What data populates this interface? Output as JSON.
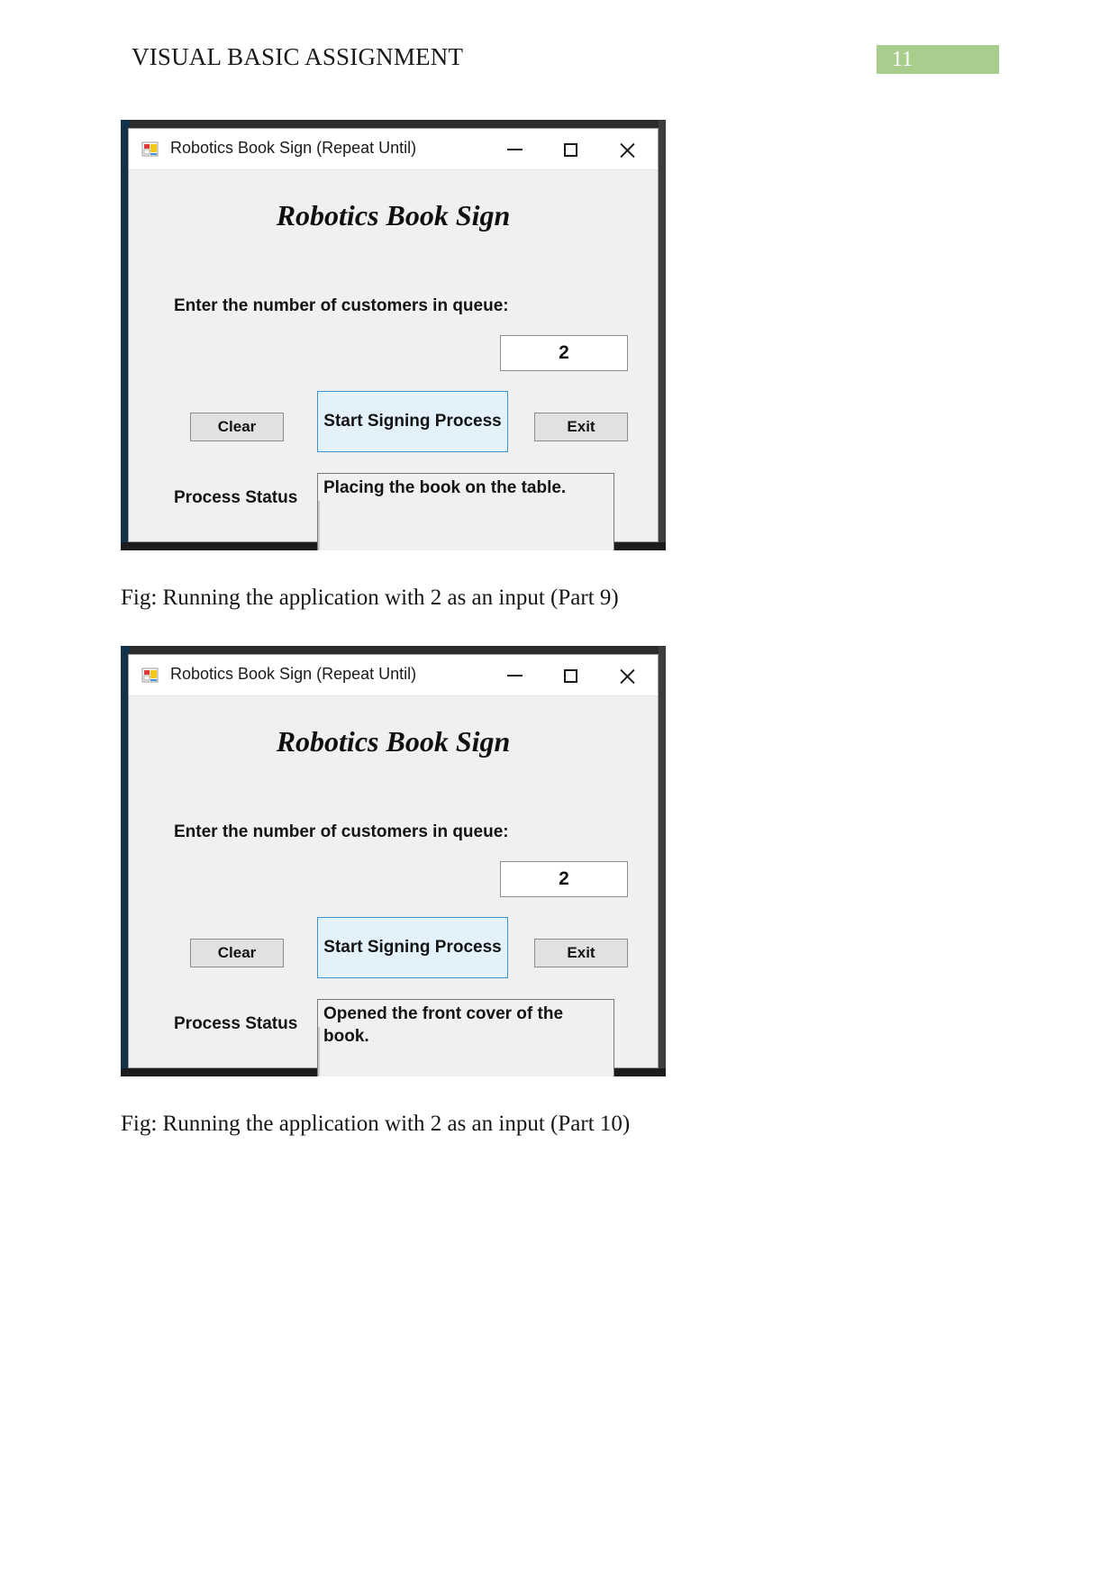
{
  "header": {
    "title": "VISUAL BASIC ASSIGNMENT",
    "page_number": "11",
    "badge_color": "#a9cd8d"
  },
  "figures": [
    {
      "window": {
        "title": "Robotics Book Sign (Repeat Until)",
        "icon": "vb-form-icon",
        "minimize": "—",
        "maximize": "□",
        "close": "✕",
        "heading": "Robotics Book Sign",
        "prompt_label": "Enter the number of customers in queue:",
        "quantity_value": "2",
        "buttons": {
          "clear": "Clear",
          "start": "Start Signing Process",
          "exit": "Exit"
        },
        "status_label": "Process Status",
        "status_text": "Placing the book on the table.",
        "accent_color": "#3e95d6",
        "focus_fill": "#e3f1fb"
      },
      "caption": "Fig: Running the application with 2 as an input (Part 9)"
    },
    {
      "window": {
        "title": "Robotics Book Sign (Repeat Until)",
        "icon": "vb-form-icon",
        "minimize": "—",
        "maximize": "□",
        "close": "✕",
        "heading": "Robotics Book Sign",
        "prompt_label": "Enter the number of customers in queue:",
        "quantity_value": "2",
        "buttons": {
          "clear": "Clear",
          "start": "Start Signing Process",
          "exit": "Exit"
        },
        "status_label": "Process Status",
        "status_text": "Opened the front cover of the book.",
        "accent_color": "#3e95d6",
        "focus_fill": "#e3f1fb"
      },
      "caption": "Fig: Running the application with 2 as an input (Part 10)"
    }
  ]
}
